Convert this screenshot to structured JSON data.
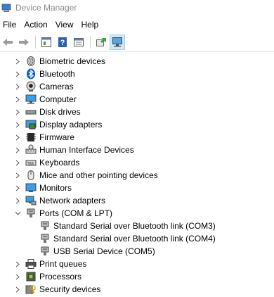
{
  "window": {
    "title": "Device Manager"
  },
  "menu": [
    "File",
    "Action",
    "View",
    "Help"
  ],
  "toolbar": {
    "buttons": [
      "back-arrow-icon",
      "forward-arrow-icon",
      "properties-icon",
      "help-icon",
      "view-icon",
      "update-driver-icon",
      "scan-hardware-icon"
    ]
  },
  "tree": {
    "categories": [
      {
        "label": "Biometric devices",
        "icon": "fingerprint-icon",
        "expanded": false
      },
      {
        "label": "Bluetooth",
        "icon": "bluetooth-icon",
        "expanded": false
      },
      {
        "label": "Cameras",
        "icon": "camera-icon",
        "expanded": false
      },
      {
        "label": "Computer",
        "icon": "computer-icon",
        "expanded": false
      },
      {
        "label": "Disk drives",
        "icon": "disk-drive-icon",
        "expanded": false
      },
      {
        "label": "Display adapters",
        "icon": "display-adapter-icon",
        "expanded": false
      },
      {
        "label": "Firmware",
        "icon": "firmware-icon",
        "expanded": false
      },
      {
        "label": "Human Interface Devices",
        "icon": "hid-icon",
        "expanded": false
      },
      {
        "label": "Keyboards",
        "icon": "keyboard-icon",
        "expanded": false
      },
      {
        "label": "Mice and other pointing devices",
        "icon": "mouse-icon",
        "expanded": false
      },
      {
        "label": "Monitors",
        "icon": "monitor-icon",
        "expanded": false
      },
      {
        "label": "Network adapters",
        "icon": "network-adapter-icon",
        "expanded": false
      },
      {
        "label": "Ports (COM & LPT)",
        "icon": "port-icon",
        "expanded": true,
        "children": [
          "Standard Serial over Bluetooth link (COM3)",
          "Standard Serial over Bluetooth link (COM4)",
          "USB Serial Device (COM5)"
        ]
      },
      {
        "label": "Print queues",
        "icon": "printer-icon",
        "expanded": false
      },
      {
        "label": "Processors",
        "icon": "processor-icon",
        "expanded": false
      },
      {
        "label": "Security devices",
        "icon": "security-device-icon",
        "expanded": false
      }
    ]
  },
  "colors": {
    "accent": "#0078d7",
    "title_text": "#8a8a8a",
    "active_button_bg": "#cce8ff"
  }
}
